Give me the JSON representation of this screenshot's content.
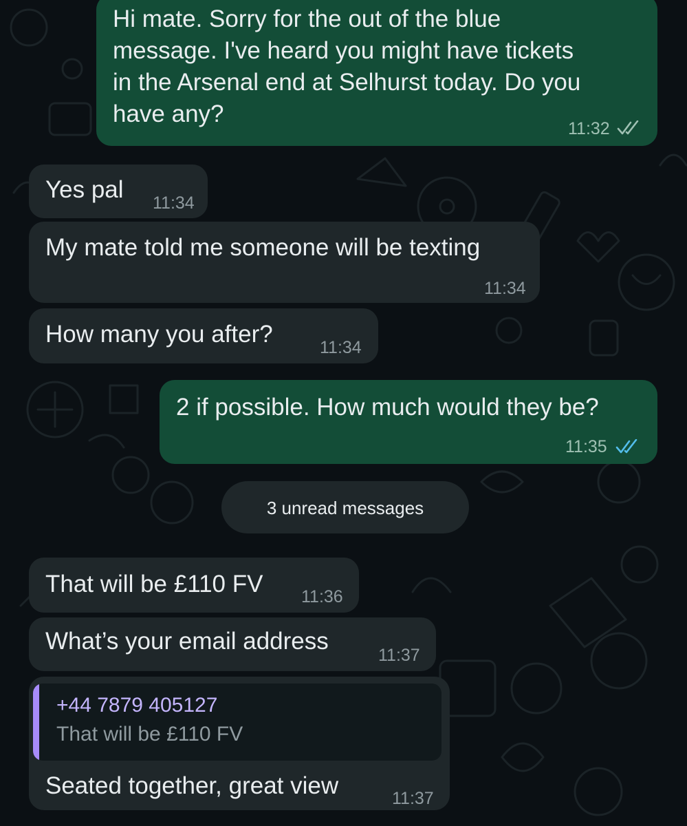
{
  "chat": {
    "messages": [
      {
        "direction": "outgoing",
        "lines": [
          "Hi mate. Sorry for the out of the blue",
          "message. I've heard you might have tickets",
          "in the Arsenal end at Selhurst today. Do you",
          "have any?"
        ],
        "time": "11:32",
        "status": "read-grey-ticks"
      },
      {
        "direction": "incoming",
        "text": "Yes pal",
        "time": "11:34"
      },
      {
        "direction": "incoming",
        "text": "My mate told me someone will be texting",
        "time": "11:34"
      },
      {
        "direction": "incoming",
        "text": "How many you after?",
        "time": "11:34"
      },
      {
        "direction": "outgoing",
        "text": "2 if possible. How much would they be?",
        "time": "11:35",
        "status": "read-blue-ticks"
      },
      {
        "direction": "incoming",
        "text": "That will be £110 FV",
        "time": "11:36"
      },
      {
        "direction": "incoming",
        "text": "What’s your email address",
        "time": "11:37"
      },
      {
        "direction": "incoming",
        "quoted": {
          "sender": "+44 7879 405127",
          "text": "That will be £110 FV"
        },
        "text": "Seated together, great view",
        "time": "11:37"
      }
    ],
    "unread_label": "3 unread messages"
  },
  "colors": {
    "background": "#0b1014",
    "incoming_bubble": "#1f272a",
    "outgoing_bubble": "#134d37",
    "read_tick_blue": "#53bdeb",
    "quote_accent": "#a78bfa"
  },
  "icons": [
    "double-check-icon",
    "doodle-wallpaper"
  ]
}
